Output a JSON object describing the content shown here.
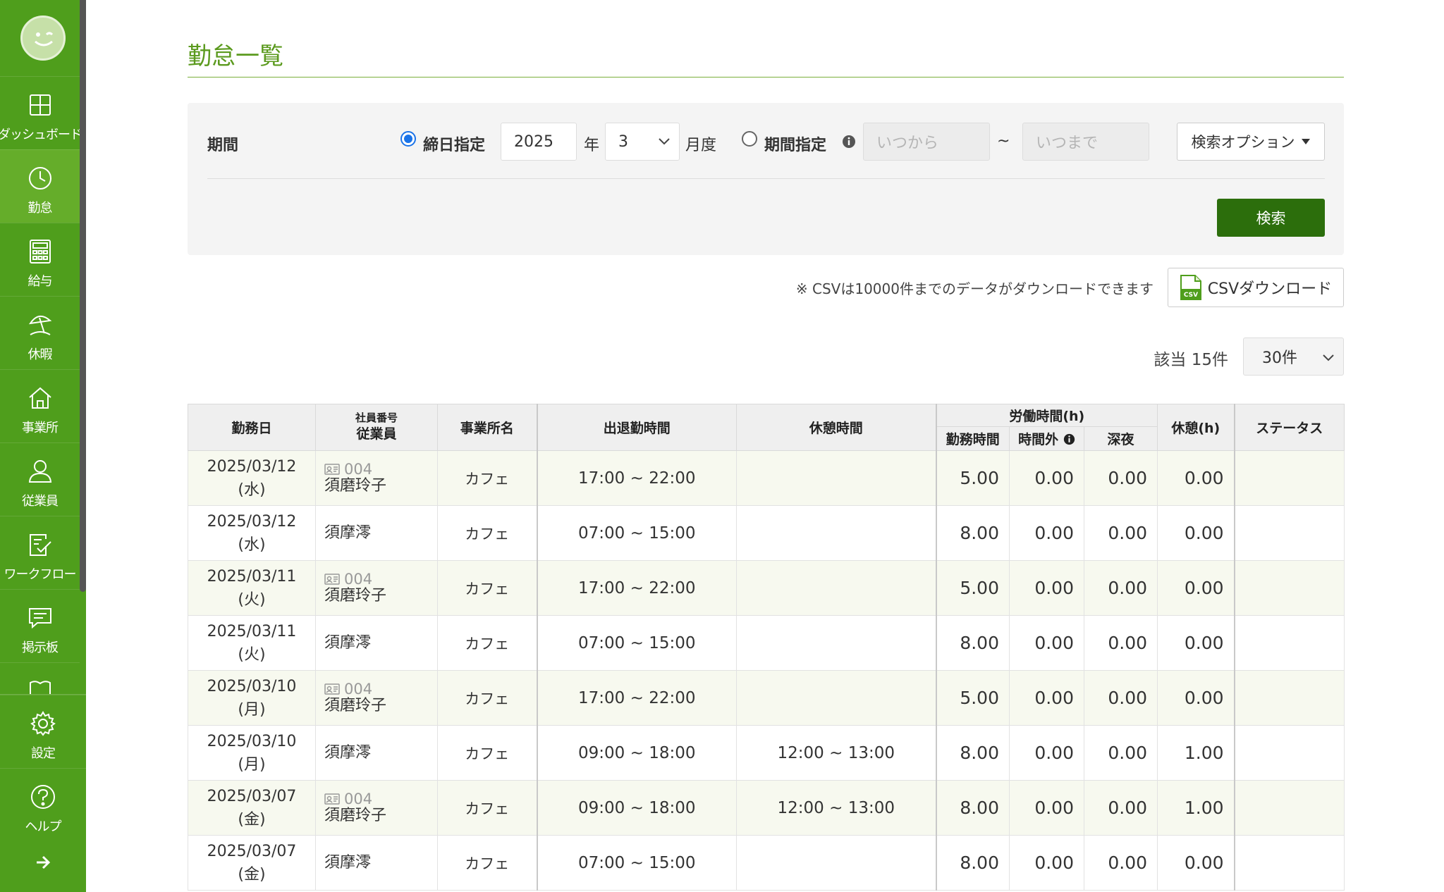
{
  "sidebar": {
    "items": [
      {
        "label": "ダッシュボード",
        "icon": "dashboard-icon"
      },
      {
        "label": "勤怠",
        "icon": "clock-icon",
        "active": true
      },
      {
        "label": "給与",
        "icon": "calculator-icon"
      },
      {
        "label": "休暇",
        "icon": "beach-umbrella-icon"
      },
      {
        "label": "事業所",
        "icon": "home-icon"
      },
      {
        "label": "従業員",
        "icon": "user-icon"
      },
      {
        "label": "ワークフロー",
        "icon": "checklist-icon"
      },
      {
        "label": "掲示板",
        "icon": "message-icon"
      }
    ],
    "bottom": [
      {
        "label": "設定",
        "icon": "gear-icon"
      },
      {
        "label": "ヘルプ",
        "icon": "help-icon"
      }
    ]
  },
  "page": {
    "title": "勤怠一覧"
  },
  "search": {
    "period_label": "期間",
    "closing_day_label": "締日指定",
    "year_value": "2025",
    "year_unit": "年",
    "month_value": "3",
    "month_unit": "月度",
    "range_label": "期間指定",
    "from_placeholder": "いつから",
    "tilde": "~",
    "to_placeholder": "いつまで",
    "option_button": "検索オプション",
    "search_button": "検索"
  },
  "csv": {
    "note": "※ CSVは10000件までのデータがダウンロードできます",
    "button": "CSVダウンロード"
  },
  "results": {
    "count_label": "該当 15件",
    "per_page": "30件"
  },
  "table": {
    "headers": {
      "date": "勤務日",
      "emp_no": "社員番号",
      "employee": "従業員",
      "office": "事業所名",
      "clock": "出退勤時間",
      "break": "休憩時間",
      "labor_group": "労働時間(h)",
      "work": "勤務時間",
      "overtime": "時間外",
      "night": "深夜",
      "break_h": "休憩(h)",
      "status": "ステータス"
    },
    "rows": [
      {
        "date": "2025/03/12",
        "dow": "(水)",
        "code": "004",
        "name": "須磨玲子",
        "office": "カフェ",
        "clock": "17:00 ~ 22:00",
        "break": "",
        "work": "5.00",
        "overtime": "0.00",
        "night": "0.00",
        "break_h": "0.00",
        "status": ""
      },
      {
        "date": "2025/03/12",
        "dow": "(水)",
        "code": "",
        "name": "須摩澪",
        "office": "カフェ",
        "clock": "07:00 ~ 15:00",
        "break": "",
        "work": "8.00",
        "overtime": "0.00",
        "night": "0.00",
        "break_h": "0.00",
        "status": ""
      },
      {
        "date": "2025/03/11",
        "dow": "(火)",
        "code": "004",
        "name": "須磨玲子",
        "office": "カフェ",
        "clock": "17:00 ~ 22:00",
        "break": "",
        "work": "5.00",
        "overtime": "0.00",
        "night": "0.00",
        "break_h": "0.00",
        "status": ""
      },
      {
        "date": "2025/03/11",
        "dow": "(火)",
        "code": "",
        "name": "須摩澪",
        "office": "カフェ",
        "clock": "07:00 ~ 15:00",
        "break": "",
        "work": "8.00",
        "overtime": "0.00",
        "night": "0.00",
        "break_h": "0.00",
        "status": ""
      },
      {
        "date": "2025/03/10",
        "dow": "(月)",
        "code": "004",
        "name": "須磨玲子",
        "office": "カフェ",
        "clock": "17:00 ~ 22:00",
        "break": "",
        "work": "5.00",
        "overtime": "0.00",
        "night": "0.00",
        "break_h": "0.00",
        "status": ""
      },
      {
        "date": "2025/03/10",
        "dow": "(月)",
        "code": "",
        "name": "須摩澪",
        "office": "カフェ",
        "clock": "09:00 ~ 18:00",
        "break": "12:00 ~ 13:00",
        "work": "8.00",
        "overtime": "0.00",
        "night": "0.00",
        "break_h": "1.00",
        "status": ""
      },
      {
        "date": "2025/03/07",
        "dow": "(金)",
        "code": "004",
        "name": "須磨玲子",
        "office": "カフェ",
        "clock": "09:00 ~ 18:00",
        "break": "12:00 ~ 13:00",
        "work": "8.00",
        "overtime": "0.00",
        "night": "0.00",
        "break_h": "1.00",
        "status": ""
      },
      {
        "date": "2025/03/07",
        "dow": "(金)",
        "code": "",
        "name": "須摩澪",
        "office": "カフェ",
        "clock": "07:00 ~ 15:00",
        "break": "",
        "work": "8.00",
        "overtime": "0.00",
        "night": "0.00",
        "break_h": "0.00",
        "status": ""
      }
    ]
  },
  "colors": {
    "brand": "#4f9e1c",
    "active": "#65ad2a",
    "title": "#5b9a1e",
    "primary_button": "#2c6e0c"
  }
}
